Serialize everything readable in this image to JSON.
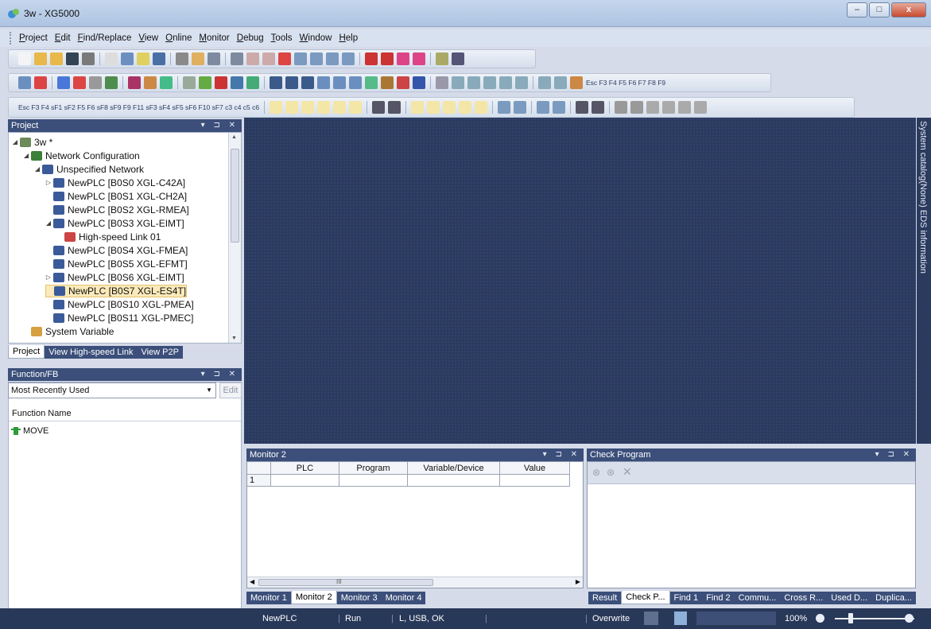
{
  "window": {
    "title": "3w - XG5000"
  },
  "menu": [
    {
      "label": "Project",
      "ul": "P"
    },
    {
      "label": "Edit",
      "ul": "E"
    },
    {
      "label": "Find/Replace",
      "ul": "F"
    },
    {
      "label": "View",
      "ul": "V"
    },
    {
      "label": "Online",
      "ul": "O"
    },
    {
      "label": "Monitor",
      "ul": "M"
    },
    {
      "label": "Debug",
      "ul": "D"
    },
    {
      "label": "Tools",
      "ul": "T"
    },
    {
      "label": "Window",
      "ul": "W"
    },
    {
      "label": "Help",
      "ul": "H"
    }
  ],
  "ladder_toolbar": {
    "top": [
      "Esc",
      "F3",
      "F4",
      "sF1",
      "sF2",
      "F5",
      "F6",
      "sF8",
      "sF9",
      "F9",
      "F11",
      "sF3",
      "sF4",
      "sF5",
      "sF6",
      "F10",
      "sF7",
      "c3",
      "c4",
      "c5",
      "c6"
    ]
  },
  "fkey_toolbar": [
    "Esc",
    "F3",
    "F4",
    "F5",
    "F6",
    "F7",
    "F8",
    "F9"
  ],
  "project_panel": {
    "title": "Project",
    "tree": [
      {
        "label": "3w *",
        "level": 0,
        "exp": "◢"
      },
      {
        "label": "Network Configuration",
        "level": 1,
        "exp": "◢"
      },
      {
        "label": "Unspecified Network",
        "level": 2,
        "exp": "◢"
      },
      {
        "label": "NewPLC [B0S0 XGL-C42A]",
        "level": 3,
        "exp": "▷"
      },
      {
        "label": "NewPLC [B0S1 XGL-CH2A]",
        "level": 3,
        "exp": ""
      },
      {
        "label": "NewPLC [B0S2 XGL-RMEA]",
        "level": 3,
        "exp": ""
      },
      {
        "label": "NewPLC [B0S3 XGL-EIMT]",
        "level": 3,
        "exp": "◢"
      },
      {
        "label": "High-speed Link 01",
        "level": 4,
        "exp": ""
      },
      {
        "label": "NewPLC [B0S4 XGL-FMEA]",
        "level": 3,
        "exp": ""
      },
      {
        "label": "NewPLC [B0S5 XGL-EFMT]",
        "level": 3,
        "exp": ""
      },
      {
        "label": "NewPLC [B0S6 XGL-EIMT]",
        "level": 3,
        "exp": "▷"
      },
      {
        "label": "NewPLC [B0S7 XGL-ES4T]",
        "level": 3,
        "exp": "",
        "selected": true
      },
      {
        "label": "NewPLC [B0S10 XGL-PMEA]",
        "level": 3,
        "exp": ""
      },
      {
        "label": "NewPLC [B0S11 XGL-PMEC]",
        "level": 3,
        "exp": ""
      },
      {
        "label": "System Variable",
        "level": 1,
        "exp": ""
      }
    ],
    "tabs": [
      "Project",
      "View High-speed Link",
      "View P2P"
    ]
  },
  "function_panel": {
    "title": "Function/FB",
    "combo_value": "Most Recently Used",
    "edit_label": "Edit",
    "column": "Function Name",
    "items": [
      "MOVE"
    ]
  },
  "catalog_strip": "System catalog(None)  EDS information",
  "monitor_panel": {
    "title": "Monitor 2",
    "columns": [
      "PLC",
      "Program",
      "Variable/Device",
      "Value"
    ],
    "row_number": "1",
    "scroll_glyph": "III",
    "tabs": [
      "Monitor 1",
      "Monitor 2",
      "Monitor 3",
      "Monitor 4"
    ]
  },
  "check_panel": {
    "title": "Check Program",
    "tabs": [
      "Result",
      "Check P...",
      "Find 1",
      "Find 2",
      "Commu...",
      "Cross R...",
      "Used D...",
      "Duplica..."
    ]
  },
  "statusbar": {
    "plc": "NewPLC",
    "mode": "Run",
    "conn": "L, USB, OK",
    "edit_mode": "Overwrite",
    "zoom": "100%"
  },
  "colors": {
    "dark_bg": "#2b3a5f",
    "panel_head": "#3b4f7a",
    "status": "#283859"
  }
}
